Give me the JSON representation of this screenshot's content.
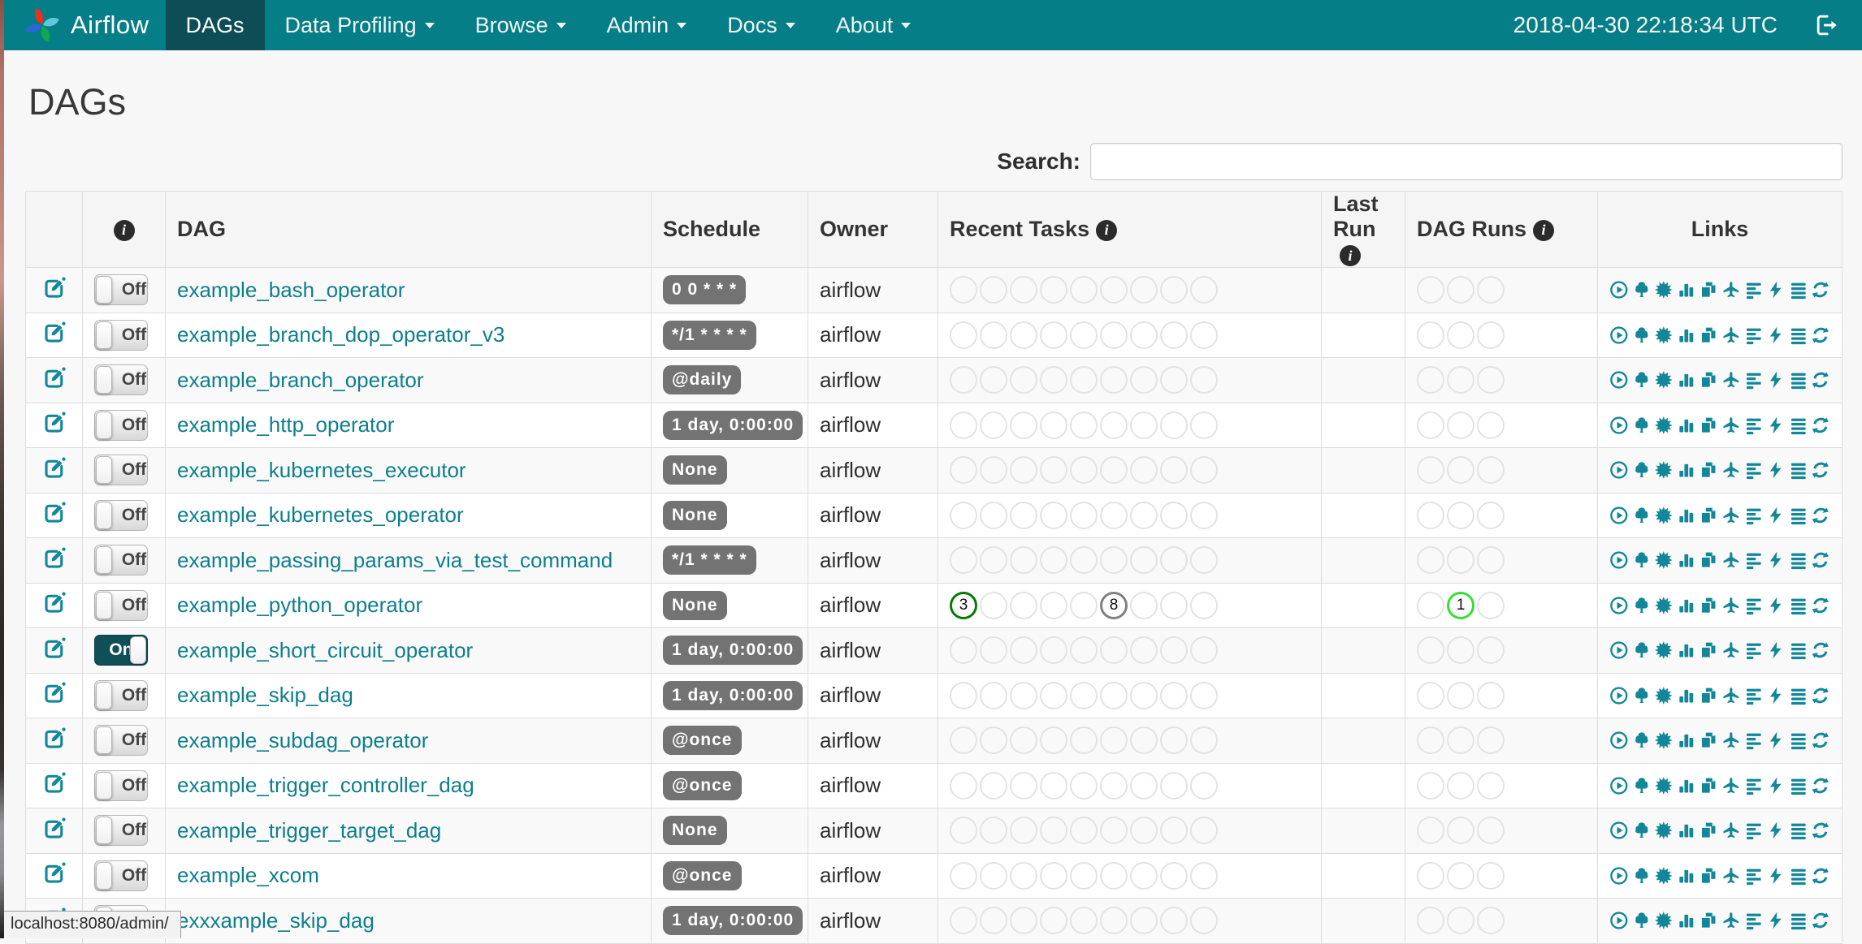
{
  "browser": {
    "status_url": "localhost:8080/admin/"
  },
  "navbar": {
    "brand": "Airflow",
    "items": [
      {
        "label": "DAGs",
        "active": true,
        "caret": false
      },
      {
        "label": "Data Profiling",
        "active": false,
        "caret": true
      },
      {
        "label": "Browse",
        "active": false,
        "caret": true
      },
      {
        "label": "Admin",
        "active": false,
        "caret": true
      },
      {
        "label": "Docs",
        "active": false,
        "caret": true
      },
      {
        "label": "About",
        "active": false,
        "caret": true
      }
    ],
    "clock": "2018-04-30 22:18:34 UTC",
    "logout_icon": "sign-out-icon"
  },
  "page": {
    "title": "DAGs",
    "search_label": "Search:",
    "search_value": ""
  },
  "colors": {
    "navbar_bg": "#067e87",
    "navbar_active_bg": "#0d4e56",
    "link_teal": "#0e7f8c",
    "icon_teal": "#128799",
    "badge_gray": "#737373",
    "toggle_on_bg": "#0f4f58",
    "state_success": "#067a06",
    "state_queued": "#808080",
    "state_running": "#35df35",
    "empty_circle_border": "#e3e3e3"
  },
  "table": {
    "headers": {
      "dag": "DAG",
      "schedule": "Schedule",
      "owner": "Owner",
      "recent_tasks": "Recent Tasks",
      "last_run_line1": "Last",
      "last_run_line2": "Run",
      "dag_runs": "DAG Runs",
      "links": "Links"
    },
    "recent_task_slots": 9,
    "dag_run_slots": 3,
    "links_icons": [
      "trigger-dag",
      "tree-view",
      "graph-view",
      "tasks-duration",
      "task-tries",
      "landing-times",
      "gantt-view",
      "code-view",
      "logs",
      "refresh"
    ],
    "rows": [
      {
        "dag_id": "example_bash_operator",
        "toggle": "Off",
        "schedule": "0 0 * * *",
        "owner": "airflow",
        "recent_tasks": [],
        "dag_runs": []
      },
      {
        "dag_id": "example_branch_dop_operator_v3",
        "toggle": "Off",
        "schedule": "*/1 * * * *",
        "owner": "airflow",
        "recent_tasks": [],
        "dag_runs": []
      },
      {
        "dag_id": "example_branch_operator",
        "toggle": "Off",
        "schedule": "@daily",
        "owner": "airflow",
        "recent_tasks": [],
        "dag_runs": []
      },
      {
        "dag_id": "example_http_operator",
        "toggle": "Off",
        "schedule": "1 day, 0:00:00",
        "owner": "airflow",
        "recent_tasks": [],
        "dag_runs": []
      },
      {
        "dag_id": "example_kubernetes_executor",
        "toggle": "Off",
        "schedule": "None",
        "owner": "airflow",
        "recent_tasks": [],
        "dag_runs": []
      },
      {
        "dag_id": "example_kubernetes_operator",
        "toggle": "Off",
        "schedule": "None",
        "owner": "airflow",
        "recent_tasks": [],
        "dag_runs": []
      },
      {
        "dag_id": "example_passing_params_via_test_command",
        "toggle": "Off",
        "schedule": "*/1 * * * *",
        "owner": "airflow",
        "recent_tasks": [],
        "dag_runs": []
      },
      {
        "dag_id": "example_python_operator",
        "toggle": "Off",
        "schedule": "None",
        "owner": "airflow",
        "recent_tasks": [
          {
            "slot": 0,
            "count": 3,
            "state": "success",
            "color": "#067a06"
          },
          {
            "slot": 5,
            "count": 8,
            "state": "queued",
            "color": "#808080"
          }
        ],
        "dag_runs": [
          {
            "slot": 1,
            "count": 1,
            "state": "running",
            "color": "#35df35"
          }
        ]
      },
      {
        "dag_id": "example_short_circuit_operator",
        "toggle": "On",
        "schedule": "1 day, 0:00:00",
        "owner": "airflow",
        "recent_tasks": [],
        "dag_runs": []
      },
      {
        "dag_id": "example_skip_dag",
        "toggle": "Off",
        "schedule": "1 day, 0:00:00",
        "owner": "airflow",
        "recent_tasks": [],
        "dag_runs": []
      },
      {
        "dag_id": "example_subdag_operator",
        "toggle": "Off",
        "schedule": "@once",
        "owner": "airflow",
        "recent_tasks": [],
        "dag_runs": []
      },
      {
        "dag_id": "example_trigger_controller_dag",
        "toggle": "Off",
        "schedule": "@once",
        "owner": "airflow",
        "recent_tasks": [],
        "dag_runs": []
      },
      {
        "dag_id": "example_trigger_target_dag",
        "toggle": "Off",
        "schedule": "None",
        "owner": "airflow",
        "recent_tasks": [],
        "dag_runs": []
      },
      {
        "dag_id": "example_xcom",
        "toggle": "Off",
        "schedule": "@once",
        "owner": "airflow",
        "recent_tasks": [],
        "dag_runs": []
      },
      {
        "dag_id": "exxxample_skip_dag",
        "toggle": "Off",
        "schedule": "1 day, 0:00:00",
        "owner": "airflow",
        "recent_tasks": [],
        "dag_runs": []
      }
    ]
  }
}
